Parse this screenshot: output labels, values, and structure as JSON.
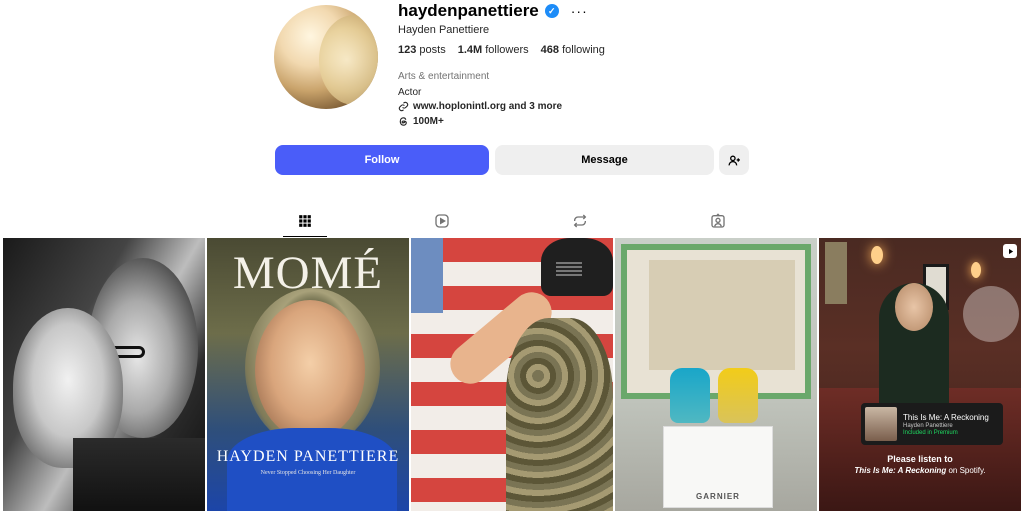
{
  "profile": {
    "username": "haydenpanettiere",
    "full_name": "Hayden Panettiere",
    "stats": {
      "posts_count": "123",
      "posts_label": "posts",
      "followers_count": "1.4M",
      "followers_label": "followers",
      "following_count": "468",
      "following_label": "following"
    },
    "category": "Arts & entertainment",
    "bio": "Actor",
    "link_text": "www.hoplonintl.org and 3 more",
    "threads_count": "100M+"
  },
  "actions": {
    "follow_label": "Follow",
    "message_label": "Message"
  },
  "tabs": [
    {
      "icon": "grid-icon",
      "active": true
    },
    {
      "icon": "reels-icon",
      "active": false
    },
    {
      "icon": "reposts-icon",
      "active": false
    },
    {
      "icon": "tagged-icon",
      "active": false
    }
  ],
  "posts": {
    "post2": {
      "magazine_title": "MOMÉ",
      "cover_name": "HAYDEN PANETTIERE",
      "cover_subtitle": "Never Stopped Choosing Her Daughter"
    },
    "post4": {
      "brand": "GARNIER"
    },
    "post5": {
      "book_title": "This Is Me: A Reckoning",
      "book_author": "Hayden Panettiere",
      "book_badge": "Included in Premium",
      "caption_line1": "Please listen to",
      "caption_title": "This Is Me: A Reckoning",
      "caption_suffix": " on Spotify."
    }
  },
  "colors": {
    "follow_button": "#4a5df9",
    "secondary_button": "#efefef",
    "verified_badge": "#1d8cf8"
  }
}
